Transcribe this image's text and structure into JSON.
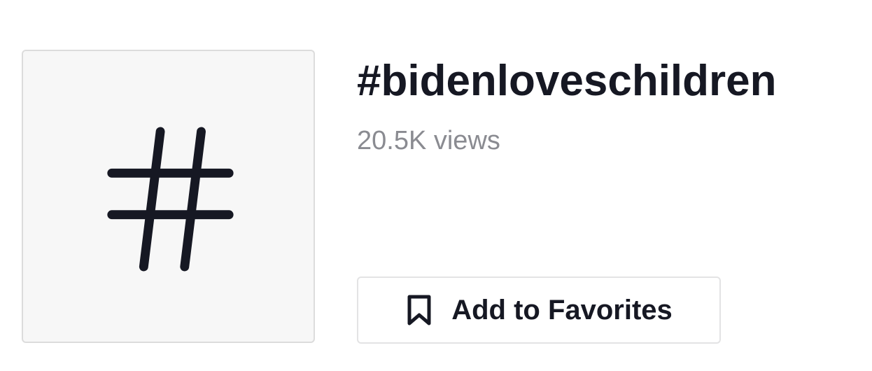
{
  "hashtag": {
    "avatar_icon": "hashtag-icon",
    "title": "#bidenloveschildren",
    "views": "20.5K views"
  },
  "favorite_button": {
    "icon": "bookmark-icon",
    "label": "Add to Favorites"
  },
  "colors": {
    "text_primary": "#161823",
    "text_secondary": "#8a8b91",
    "avatar_background": "#f7f7f7",
    "border": "#e3e3e4"
  }
}
